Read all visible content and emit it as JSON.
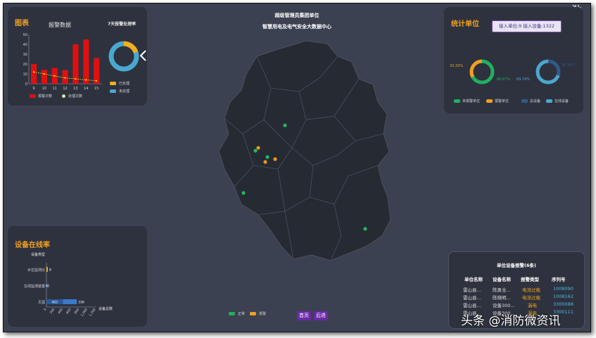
{
  "header": {
    "line1": "超级管理员集团单位",
    "line2": "智慧用电及电气安全大数据中心"
  },
  "chart_panel": {
    "title": "图表",
    "bar_title": "报警数据",
    "donut_title": "7天报警处理率",
    "legend_alarm": "报警次数",
    "legend_processed": "处理次数",
    "legend_done": "已处理",
    "legend_undone": "未处理",
    "nav_arrow": "chevron-left-icon"
  },
  "chart_data": [
    {
      "type": "bar",
      "title": "报警数据",
      "categories": [
        "9",
        "10",
        "11",
        "12",
        "13",
        "14",
        "15"
      ],
      "series": [
        {
          "name": "报警次数",
          "type": "bar",
          "values": [
            20,
            14,
            16,
            14,
            40,
            45,
            26
          ]
        },
        {
          "name": "处理次数",
          "type": "line",
          "values": [
            12,
            10,
            8,
            6,
            5,
            4,
            3
          ]
        }
      ],
      "ylim": [
        0,
        50
      ],
      "yticks": [
        "0",
        "10",
        "20",
        "30",
        "40",
        "50"
      ],
      "colors": {
        "bar": "#e01010",
        "line": "#d8d020"
      }
    },
    {
      "type": "pie",
      "title": "7天报警处理率",
      "labels": [
        "已处理",
        "未处理"
      ],
      "values": [
        20,
        80
      ],
      "colors": [
        "#f0b020",
        "#4aa8d0"
      ]
    },
    {
      "type": "pie",
      "labels": [
        "未报警单位",
        "报警单位"
      ],
      "values": [
        66.67,
        33.33
      ],
      "value_labels": [
        "66.67%",
        "33.33%"
      ],
      "colors": [
        "#20b060",
        "#f0a020"
      ]
    },
    {
      "type": "pie",
      "labels": [
        "总设备",
        "在线设备"
      ],
      "values": [
        30.26,
        69.74
      ],
      "value_labels": [
        "30.26%",
        "69.74%"
      ],
      "colors": [
        "#2e5a8a",
        "#4aa8d0"
      ]
    },
    {
      "type": "bar",
      "orientation": "horizontal",
      "ylabel": "设备类型",
      "xlabel": "设备总数",
      "categories": [
        "灭弧",
        "在线监测装置",
        "水位监测仪"
      ],
      "series": [
        {
          "name": "在线",
          "values": [
            403,
            40,
            0
          ],
          "labels": [
            "403",
            "40",
            ""
          ]
        },
        {
          "name": "离线",
          "values": [
            336,
            0,
            8
          ],
          "labels": [
            "336",
            "",
            "8"
          ]
        }
      ],
      "xticks": [
        "0",
        "200",
        "400",
        "600",
        "800",
        "1,000",
        "1,200"
      ],
      "xlim": [
        0,
        1200
      ],
      "colors": {
        "online": "#2a5a9a",
        "offline": "#f0a020"
      }
    }
  ],
  "stats_panel": {
    "title": "统计单位",
    "info_badge": "接入单位:9  接入设备:1322",
    "legend": [
      "未报警单位",
      "报警单位",
      "总设备",
      "在线设备"
    ],
    "legend_colors": [
      "#20b060",
      "#f0a020",
      "#2e5a8a",
      "#4aa8d0"
    ]
  },
  "online_panel": {
    "title": "设备在线率"
  },
  "alarm_table": {
    "title": "单位设备报警(6条)",
    "columns": [
      "单位名称",
      "设备名称",
      "报警类型",
      "序列号"
    ],
    "rows": [
      [
        "雷山县…",
        "陈勇全…",
        "电流过载",
        "1008090"
      ],
      [
        "雷山县…",
        "陈晓明…",
        "电流过载",
        "1008162"
      ],
      [
        "雷山县…",
        "设备300…",
        "漏电",
        "3300088"
      ],
      [
        "雷山县…",
        "设备300…",
        "漏电",
        "3300111"
      ]
    ]
  },
  "map": {
    "legend_normal": "正常",
    "legend_alarm": "报警",
    "colors": {
      "region": "#262a33",
      "border": "#4a505c",
      "normal": "#20c060",
      "alarm": "#f0a020"
    }
  },
  "pager": {
    "home": "首页",
    "back": "后退"
  },
  "corner_icon": "fullscreen-exit-icon",
  "watermark": "头条 @消防微资讯"
}
